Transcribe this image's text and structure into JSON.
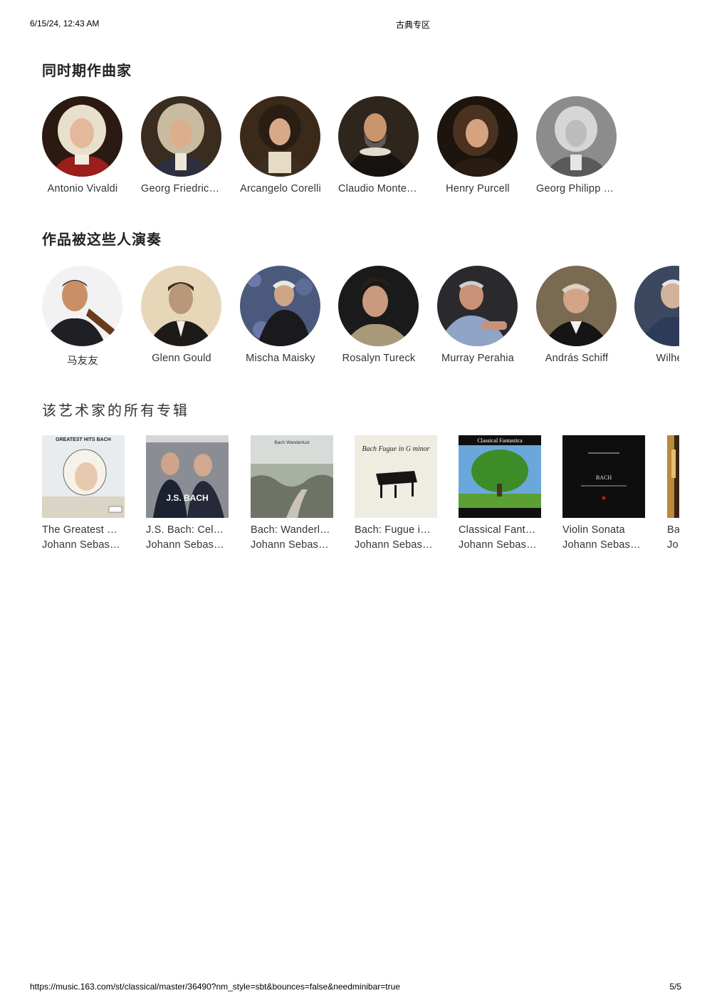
{
  "print_header": {
    "datetime": "6/15/24, 12:43 AM",
    "page_title": "古典专区"
  },
  "print_footer": {
    "url": "https://music.163.com/st/classical/master/36490?nm_style=sbt&bounces=false&needminibar=true",
    "page_number": "5/5"
  },
  "sections": {
    "contemporaries": {
      "title": "同时期作曲家",
      "items": [
        {
          "name": "Antonio Vivaldi"
        },
        {
          "name": "Georg Friedrich Händel"
        },
        {
          "name": "Arcangelo Corelli"
        },
        {
          "name": "Claudio Monteverdi"
        },
        {
          "name": "Henry Purcell"
        },
        {
          "name": "Georg Philipp Telemann"
        }
      ]
    },
    "performers": {
      "title": "作品被这些人演奏",
      "items": [
        {
          "name": "马友友"
        },
        {
          "name": "Glenn Gould"
        },
        {
          "name": "Mischa Maisky"
        },
        {
          "name": "Rosalyn Tureck"
        },
        {
          "name": "Murray Perahia"
        },
        {
          "name": "András Schiff"
        },
        {
          "name": "Wilhelm"
        }
      ]
    },
    "albums": {
      "title": "该艺术家的所有专辑",
      "items": [
        {
          "title": "The Greatest Hits",
          "artist": "Johann Sebastian Bach",
          "cover_text": "GREATEST HITS BACH"
        },
        {
          "title": "J.S. Bach: Cello Suites",
          "artist": "Johann Sebastian Bach",
          "cover_text": "J.S. BACH"
        },
        {
          "title": "Bach: Wanderlust",
          "artist": "Johann Sebastian Bach",
          "cover_text": "Bach Wanderlust"
        },
        {
          "title": "Bach: Fugue in G minor",
          "artist": "Johann Sebastian Bach",
          "cover_text": "Bach Fugue in G minor"
        },
        {
          "title": "Classical Fantastica",
          "artist": "Johann Sebastian Bach",
          "cover_text": "Classical Fantastica"
        },
        {
          "title": "Violin Sonata",
          "artist": "Johann Sebastian Bach",
          "cover_text": "BACH"
        },
        {
          "title": "Ba",
          "artist": "Jo",
          "cover_text": ""
        }
      ]
    }
  },
  "colors": {
    "background": "#ffffff",
    "text": "#333333",
    "title": "#222222"
  }
}
